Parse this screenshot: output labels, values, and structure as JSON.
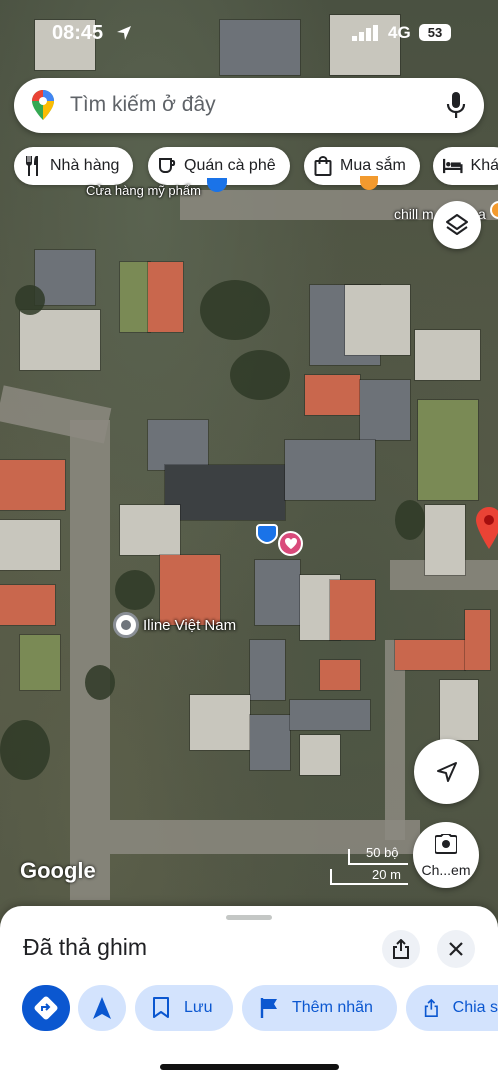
{
  "status_bar": {
    "time": "08:45",
    "network": "4G",
    "battery": "53"
  },
  "search": {
    "placeholder": "Tìm kiếm ở đây",
    "icon_left": "maps-pin-icon",
    "icon_right": "mic-icon"
  },
  "chips": [
    {
      "label": "Nhà hàng",
      "icon": "restaurant-icon"
    },
    {
      "label": "Quán cà phê",
      "icon": "coffee-icon"
    },
    {
      "label": "Mua sắm",
      "icon": "shopping-bag-icon"
    },
    {
      "label": "Khá",
      "icon": "hotel-icon"
    }
  ],
  "map": {
    "labels": [
      {
        "text": "Cửa hàng mỹ phẩm"
      },
      {
        "text": "chill m"
      },
      {
        "text": "a"
      }
    ],
    "place_label": "Iline Việt Nam",
    "google_logo": "Google",
    "scale": {
      "top": "50 bộ",
      "bottom": "20 m"
    },
    "camera_label": "Ch...em"
  },
  "sheet": {
    "title": "Đã thả ghim",
    "actions": [
      {
        "label": "",
        "icon": "directions-icon"
      },
      {
        "label": "",
        "icon": "navigation-arrow-icon"
      },
      {
        "label": "Lưu",
        "icon": "bookmark-icon"
      },
      {
        "label": "Thêm nhãn",
        "icon": "flag-icon"
      },
      {
        "label": "Chia s",
        "icon": "share-icon"
      }
    ]
  },
  "colors": {
    "accent": "#0b57d0",
    "accent_light": "#d3e3fd",
    "pin_red": "#ea4335",
    "heart_pink": "#d94a7b"
  }
}
